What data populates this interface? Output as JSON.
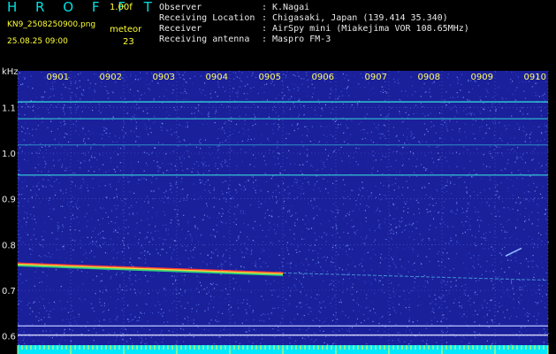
{
  "header": {
    "logo": "H R O F F T",
    "version": "1.00f",
    "filename": "KN9_2508250900.png",
    "datetime": "25.08.25 09:00",
    "meteor_label": "meteor",
    "meteor_count": "23"
  },
  "info": [
    {
      "key": "Observer",
      "sep": ":",
      "value": "K.Nagai"
    },
    {
      "key": "Receiving Location",
      "sep": ":",
      "value": "Chigasaki, Japan (139.414 35.340)"
    },
    {
      "key": "Receiver",
      "sep": ":",
      "value": "AirSpy mini (Miakejima VOR 108.65MHz)"
    },
    {
      "key": "Receiving antenna",
      "sep": ":",
      "value": "Maspro FM-3"
    }
  ],
  "chart_data": {
    "type": "heatmap",
    "ylabel": "kHz",
    "y_ticks": [
      "1.1",
      "1.0",
      "0.9",
      "0.8",
      "0.7",
      "0.6"
    ],
    "y_tick_values": [
      1.1,
      1.0,
      0.9,
      0.8,
      0.7,
      0.6
    ],
    "ylim": [
      0.58,
      1.18
    ],
    "x_ticks": [
      "0901",
      "0902",
      "0903",
      "0904",
      "0905",
      "0906",
      "0907",
      "0908",
      "0909",
      "0910"
    ],
    "grid": true,
    "background_color": "#1a1f9a",
    "horizontal_traces": [
      {
        "freq": 1.112,
        "color": "#33d6d6"
      },
      {
        "freq": 1.075,
        "color": "#2fa6c8"
      },
      {
        "freq": 1.018,
        "color": "#2a78c0"
      },
      {
        "freq": 0.952,
        "color": "#33c8d0"
      },
      {
        "freq": 0.622,
        "color": "#bfc8ff"
      },
      {
        "freq": 0.602,
        "color": "#e0e0ff"
      }
    ],
    "strong_trace": {
      "start": [
        "0900",
        0.758
      ],
      "end": [
        "0905",
        0.737
      ],
      "colors": [
        "#ff3b3b",
        "#ffd23a",
        "#2fd17a"
      ]
    },
    "weak_trace": {
      "start": [
        "0905",
        0.738
      ],
      "end": [
        "0910",
        0.722
      ],
      "color": "#4aa6d8"
    },
    "meteor_streak": {
      "start": [
        "0909.2",
        0.775
      ],
      "end": [
        "0909.5",
        0.792
      ],
      "color": "#8fb8ff"
    }
  }
}
